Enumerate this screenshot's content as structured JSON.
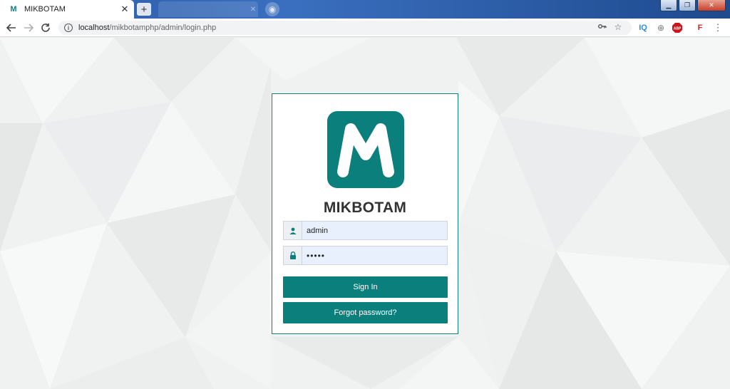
{
  "browser": {
    "active_tab": {
      "title": "MIKBOTAM",
      "favicon": "M"
    },
    "inactive_tab": {
      "title": ""
    },
    "url_host": "localhost",
    "url_path": "/mikbotamphp/admin/login.php"
  },
  "login": {
    "brand": "MIKBOTAM",
    "logo_letter": "M",
    "username": "admin",
    "password": "•••••",
    "sign_in_label": "Sign In",
    "forgot_label": "Forgot password?"
  },
  "colors": {
    "accent": "#0b7f7b",
    "input_bg": "#e8f0fe"
  },
  "icons": [
    "info-icon",
    "key-icon",
    "star-icon",
    "user-icon",
    "lock-icon",
    "back-icon",
    "forward-icon",
    "reload-icon"
  ]
}
